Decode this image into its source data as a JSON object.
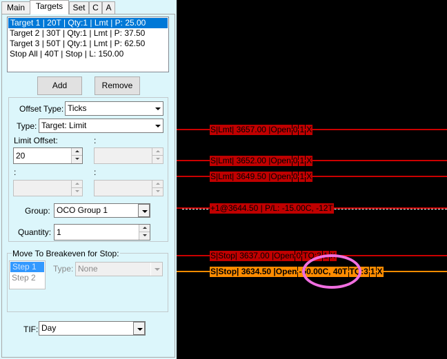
{
  "tabs": [
    "Main",
    "Targets",
    "Set",
    "C",
    "A"
  ],
  "targets": {
    "list": [
      "Target 1 | 20T | Qty:1 | Lmt | P: 25.00",
      "Target 2 | 30T | Qty:1 | Lmt | P: 37.50",
      "Target 3 | 50T | Qty:1 | Lmt | P: 62.50",
      "Stop All | 40T | Stop | L: 150.00"
    ],
    "add_label": "Add",
    "remove_label": "Remove",
    "offset_type_label": "Offset Type:",
    "offset_type_value": "Ticks",
    "type_label": "Type:",
    "type_value": "Target: Limit",
    "limit_offset_label": "Limit Offset:",
    "limit_offset_value": "20",
    "colon": ":",
    "group_label": "Group:",
    "group_value": "OCO Group 1",
    "quantity_label": "Quantity:",
    "quantity_value": "1",
    "breakeven_label": "Move To Breakeven for Stop:",
    "steps": [
      "Step 1",
      "Step 2"
    ],
    "be_type_label": "Type:",
    "be_type_value": "None",
    "tif_label": "TIF:",
    "tif_value": "Day"
  },
  "chart": {
    "colors": {
      "dark_red": "#c00000",
      "line_red": "#cc0000",
      "orange": "#ff8c00",
      "highlight": "#f06fe0"
    },
    "orders": [
      {
        "cells": [
          "S|Lmt| 3657.00 |Open",
          "0",
          "1",
          "X"
        ],
        "style": "red"
      },
      {
        "cells": [
          "S|Lmt| 3652.00 |Open",
          "0",
          "1",
          "X"
        ],
        "style": "red"
      },
      {
        "cells": [
          "S|Lmt| 3649.50 |Open",
          "0",
          "1",
          "X"
        ],
        "style": "red"
      },
      {
        "cells": [
          "+1@3644.50 | P/L: -15.00C, -12T"
        ],
        "style": "position"
      },
      {
        "cells": [
          "S|Stop| 3637.00 |Open",
          "0",
          "TQ:3",
          "1",
          "X"
        ],
        "style": "red"
      },
      {
        "cells": [
          "S|Stop| 3634.50 |Open",
          "-50.00C, 40T",
          "TQ:3",
          "1",
          "X"
        ],
        "style": "orange"
      }
    ]
  }
}
